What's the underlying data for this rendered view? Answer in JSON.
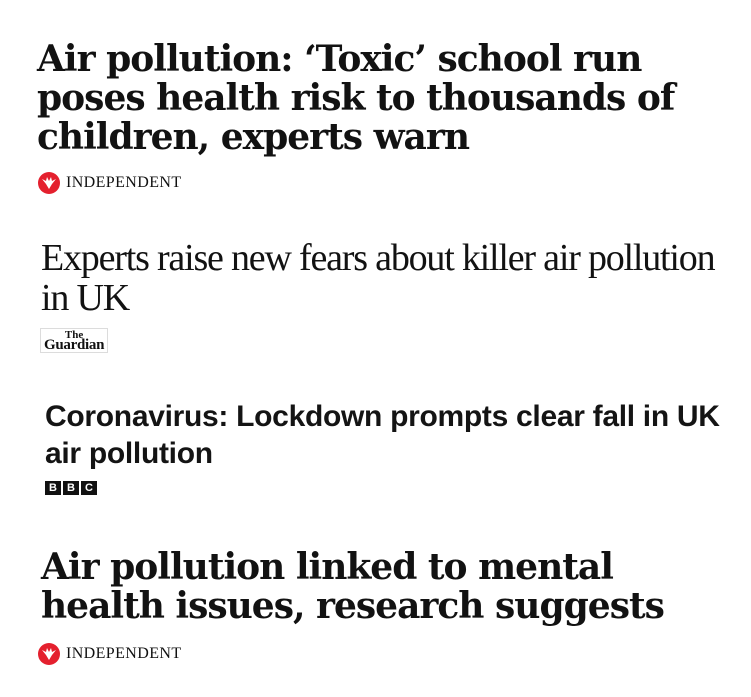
{
  "articles": [
    {
      "headline": "Air pollution: ‘Toxic’ school run poses health risk to thousands of children, experts warn",
      "source": "INDEPENDENT"
    },
    {
      "headline": "Experts raise new fears about killer air pollution in UK",
      "source": {
        "the": "The",
        "name": "Guardian"
      }
    },
    {
      "headline": "Coronavirus: Lockdown prompts clear fall in UK air pollution",
      "source": [
        "B",
        "B",
        "C"
      ]
    },
    {
      "headline": "Air pollution linked to mental health issues, research suggests",
      "source": "INDEPENDENT"
    }
  ],
  "colors": {
    "independent_red": "#e4202e",
    "text": "#111111"
  }
}
